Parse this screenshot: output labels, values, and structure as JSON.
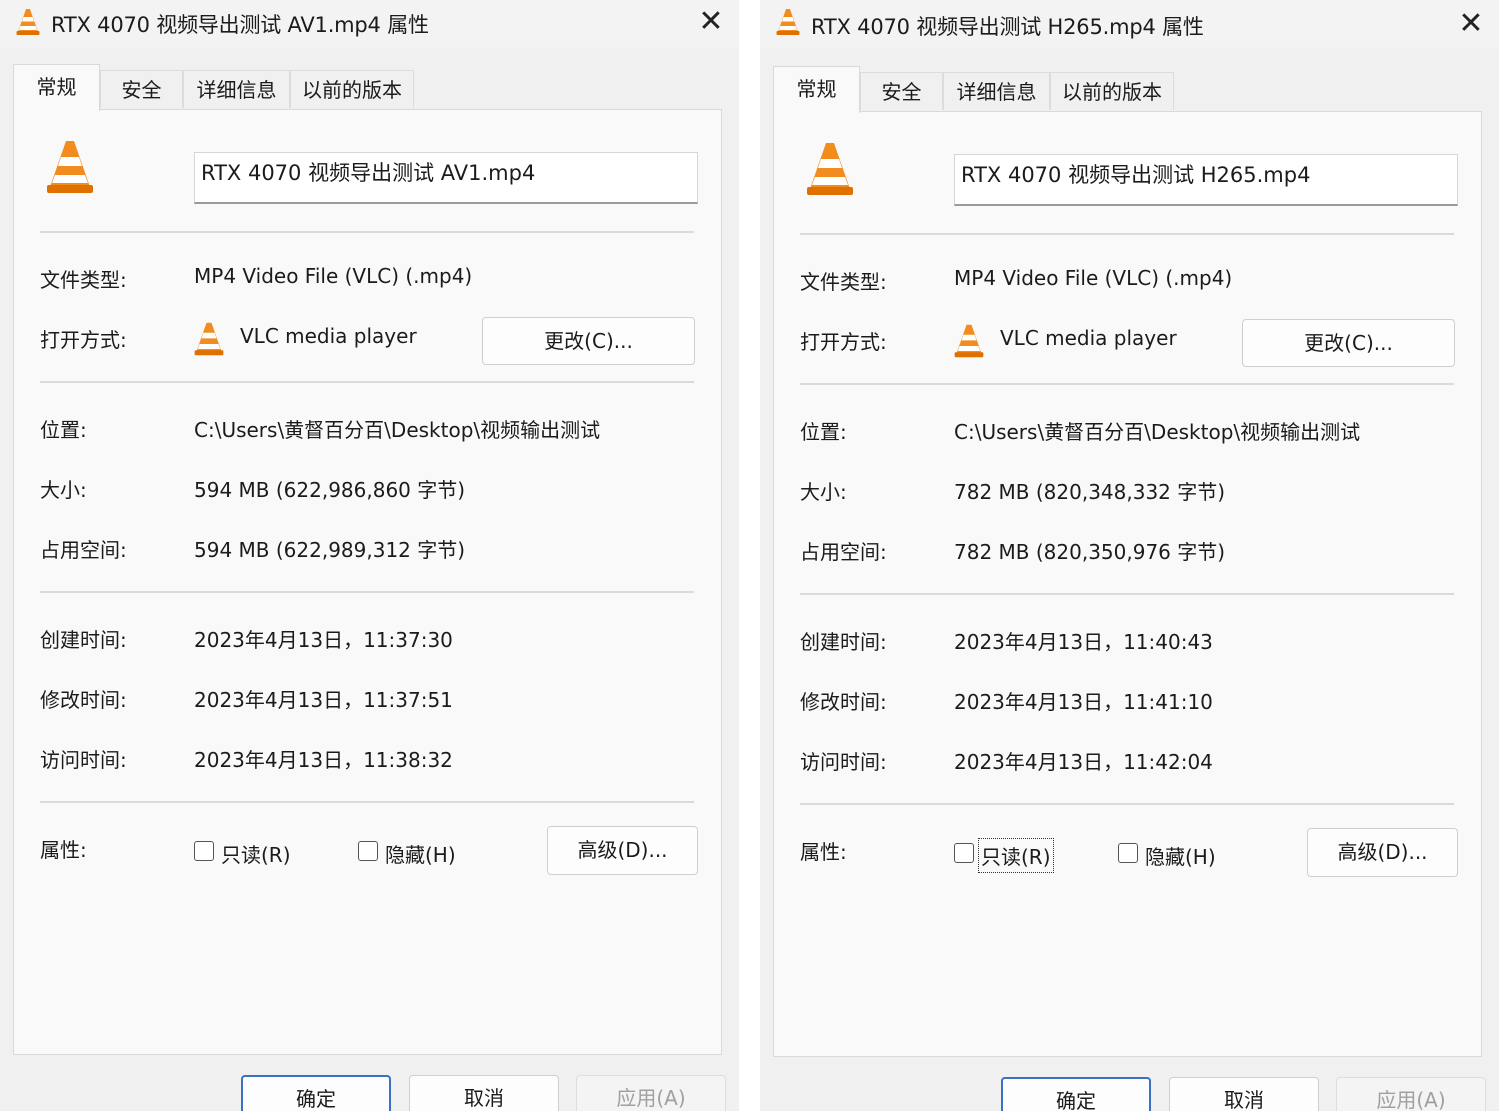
{
  "dialogs": [
    {
      "title": "RTX 4070 视频导出测试 AV1.mp4 属性",
      "tabs": [
        "常规",
        "安全",
        "详细信息",
        "以前的版本"
      ],
      "filename": "RTX 4070 视频导出测试 AV1.mp4",
      "labels": {
        "file_type": "文件类型:",
        "open_with": "打开方式:",
        "location": "位置:",
        "size": "大小:",
        "size_on_disk": "占用空间:",
        "created": "创建时间:",
        "modified": "修改时间:",
        "accessed": "访问时间:",
        "attributes": "属性:"
      },
      "file_type": "MP4 Video File (VLC) (.mp4)",
      "open_with": "VLC media player",
      "change_button": "更改(C)...",
      "location": "C:\\Users\\黄督百分百\\Desktop\\视频输出测试",
      "size": "594 MB (622,986,860 字节)",
      "size_on_disk": "594 MB (622,989,312 字节)",
      "created": "2023年4月13日，11:37:30",
      "modified": "2023年4月13日，11:37:51",
      "accessed": "2023年4月13日，11:38:32",
      "readonly_label": "只读(R)",
      "hidden_label": "隐藏(H)",
      "advanced_button": "高级(D)...",
      "ok_button": "确定",
      "cancel_button": "取消",
      "apply_button": "应用(A)"
    },
    {
      "title": "RTX 4070 视频导出测试 H265.mp4 属性",
      "tabs": [
        "常规",
        "安全",
        "详细信息",
        "以前的版本"
      ],
      "filename": "RTX 4070 视频导出测试 H265.mp4",
      "labels": {
        "file_type": "文件类型:",
        "open_with": "打开方式:",
        "location": "位置:",
        "size": "大小:",
        "size_on_disk": "占用空间:",
        "created": "创建时间:",
        "modified": "修改时间:",
        "accessed": "访问时间:",
        "attributes": "属性:"
      },
      "file_type": "MP4 Video File (VLC) (.mp4)",
      "open_with": "VLC media player",
      "change_button": "更改(C)...",
      "location": "C:\\Users\\黄督百分百\\Desktop\\视频输出测试",
      "size": "782 MB (820,348,332 字节)",
      "size_on_disk": "782 MB (820,350,976 字节)",
      "created": "2023年4月13日，11:40:43",
      "modified": "2023年4月13日，11:41:10",
      "accessed": "2023年4月13日，11:42:04",
      "readonly_label": "只读(R)",
      "hidden_label": "隐藏(H)",
      "advanced_button": "高级(D)...",
      "ok_button": "确定",
      "cancel_button": "取消",
      "apply_button": "应用(A)"
    }
  ],
  "colors": {
    "vlc_orange": "#f28c1e",
    "vlc_white_band": "#ffffff",
    "primary_border": "#3c70c4",
    "window_bg": "#f0f0f0",
    "panel_bg": "#f9f9f9"
  },
  "icons": {
    "app": "vlc-cone-icon",
    "close": "close-icon",
    "checkbox": "checkbox-unchecked"
  }
}
